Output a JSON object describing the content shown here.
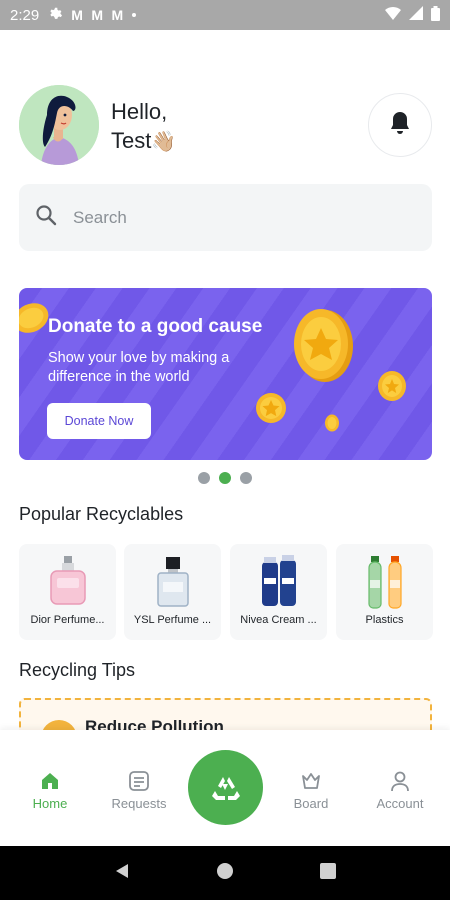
{
  "status_bar": {
    "time": "2:29",
    "mail_glyph": "M"
  },
  "header": {
    "greeting_line1": "Hello,",
    "user_name": "Test",
    "wave": "👋🏼"
  },
  "search": {
    "placeholder": "Search"
  },
  "banner": {
    "title": "Donate to a good cause",
    "text": "Show your love by making a difference in the world",
    "button": "Donate Now"
  },
  "carousel": {
    "pages": 3,
    "active": 2
  },
  "sections": {
    "recyclables_title": "Popular Recyclables",
    "tips_title": "Recycling Tips"
  },
  "recyclables": [
    {
      "label": "Dior Perfume...",
      "icon": "perfume-bottle-pink"
    },
    {
      "label": "YSL Perfume ...",
      "icon": "perfume-bottle-blue"
    },
    {
      "label": "Nivea Cream ...",
      "icon": "cream-bottles"
    },
    {
      "label": "Plastics",
      "icon": "plastic-bottles"
    }
  ],
  "tips": [
    {
      "title": "Reduce Pollution"
    }
  ],
  "bottom_nav": {
    "items": [
      {
        "label": "Home",
        "icon": "home-icon",
        "active": true
      },
      {
        "label": "Requests",
        "icon": "requests-icon",
        "active": false
      },
      {
        "label": "Board",
        "icon": "board-icon",
        "active": false
      },
      {
        "label": "Account",
        "icon": "account-icon",
        "active": false
      }
    ],
    "fab_icon": "recycle-icon"
  },
  "colors": {
    "accent": "#4caf50",
    "banner": "#7a63ee",
    "coin": "#f6b829",
    "tip_border": "#f2b33d"
  }
}
